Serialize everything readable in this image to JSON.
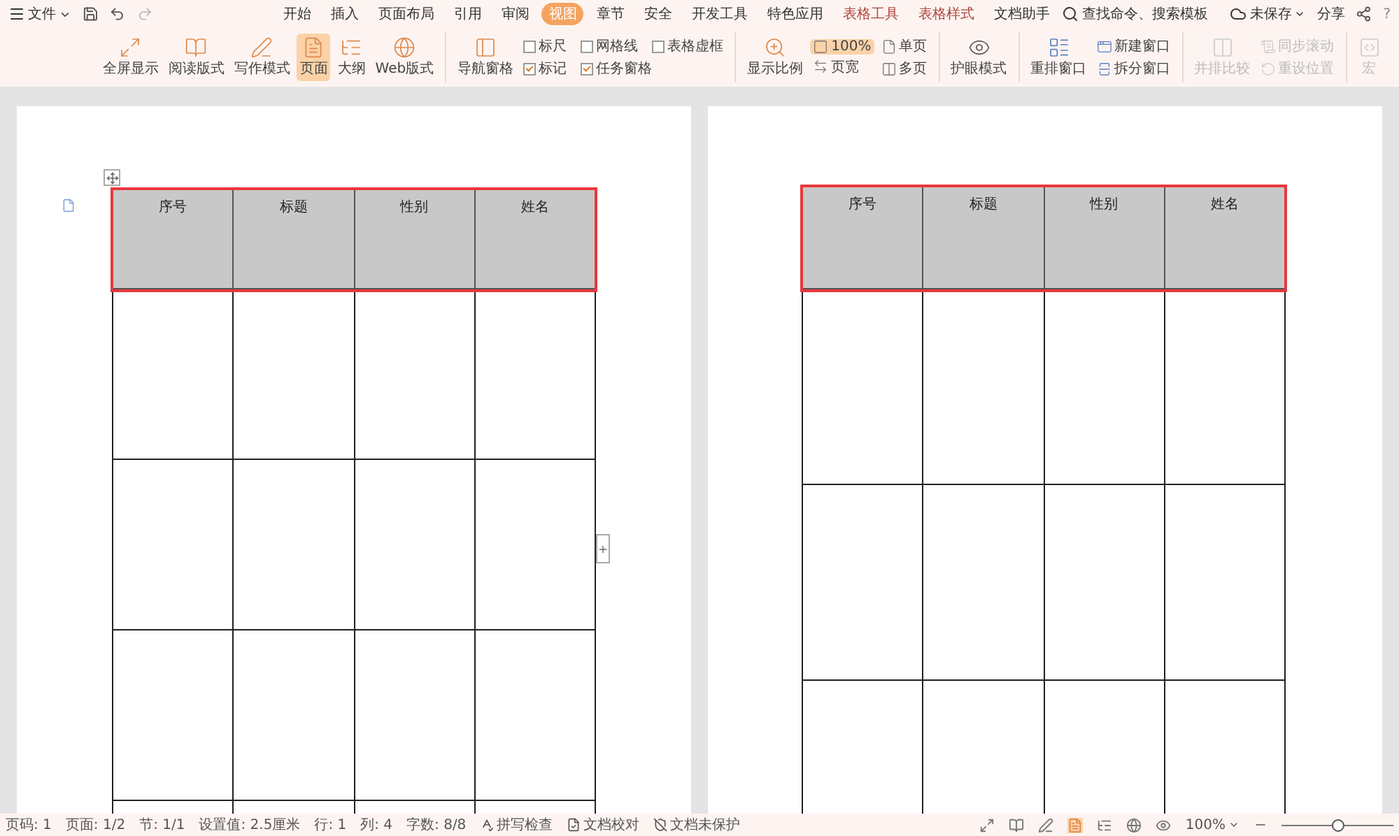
{
  "title_bar": {
    "menu": "文件"
  },
  "tabs": [
    {
      "label": "开始",
      "selected": false,
      "kind": "normal"
    },
    {
      "label": "插入",
      "selected": false,
      "kind": "normal"
    },
    {
      "label": "页面布局",
      "selected": false,
      "kind": "normal"
    },
    {
      "label": "引用",
      "selected": false,
      "kind": "normal"
    },
    {
      "label": "审阅",
      "selected": false,
      "kind": "normal"
    },
    {
      "label": "视图",
      "selected": true,
      "kind": "normal"
    },
    {
      "label": "章节",
      "selected": false,
      "kind": "normal"
    },
    {
      "label": "安全",
      "selected": false,
      "kind": "normal"
    },
    {
      "label": "开发工具",
      "selected": false,
      "kind": "normal"
    },
    {
      "label": "特色应用",
      "selected": false,
      "kind": "normal"
    },
    {
      "label": "表格工具",
      "selected": false,
      "kind": "context"
    },
    {
      "label": "表格样式",
      "selected": false,
      "kind": "context"
    },
    {
      "label": "文档助手",
      "selected": false,
      "kind": "normal"
    }
  ],
  "search": {
    "placeholder": "查找命令、搜索模板"
  },
  "account": {
    "save_status": "未保存",
    "share": "分享",
    "help": "?"
  },
  "ribbon": {
    "views": [
      {
        "label": "全屏显示",
        "selected": false
      },
      {
        "label": "阅读版式",
        "selected": false
      },
      {
        "label": "写作模式",
        "selected": false
      },
      {
        "label": "页面",
        "selected": true
      },
      {
        "label": "大纲",
        "selected": false
      },
      {
        "label": "Web版式",
        "selected": false
      }
    ],
    "navigation": {
      "label": "导航窗格"
    },
    "checks": [
      {
        "label": "标尺",
        "checked": false
      },
      {
        "label": "网格线",
        "checked": false
      },
      {
        "label": "表格虚框",
        "checked": false
      },
      {
        "label": "标记",
        "checked": true
      },
      {
        "label": "任务窗格",
        "checked": true
      }
    ],
    "zoom": {
      "label": "显示比例",
      "options": [
        {
          "label": "100%",
          "selected": true
        },
        {
          "label": "页宽",
          "selected": false
        },
        {
          "label": "单页",
          "selected": false
        },
        {
          "label": "多页",
          "selected": false
        }
      ]
    },
    "eye_mode": {
      "label": "护眼模式"
    },
    "windows": {
      "arrange": "重排窗口",
      "new": "新建窗口",
      "split": "拆分窗口"
    },
    "compare": [
      {
        "label": "并排比较",
        "disabled": true
      },
      {
        "label": "同步滚动",
        "disabled": true
      },
      {
        "label": "重设位置",
        "disabled": true
      }
    ],
    "macro": {
      "label": "宏",
      "disabled": true
    }
  },
  "pages": [
    {
      "table": {
        "columns": [
          "序号",
          "标题",
          "性别",
          "姓名"
        ],
        "header_selected": true
      }
    },
    {
      "table": {
        "columns": [
          "序号",
          "标题",
          "性别",
          "姓名"
        ],
        "header_selected": true
      }
    }
  ],
  "status_bar": {
    "items": [
      "页码: 1",
      "页面: 1/2",
      "节: 1/1",
      "设置值: 2.5厘米",
      "行: 1",
      "列: 4",
      "字数: 8/8"
    ],
    "tools": [
      "拼写检查",
      "文档校对",
      "文档未保护"
    ],
    "zoom": "100%",
    "zoom_level": {
      "level": 0.5
    }
  }
}
